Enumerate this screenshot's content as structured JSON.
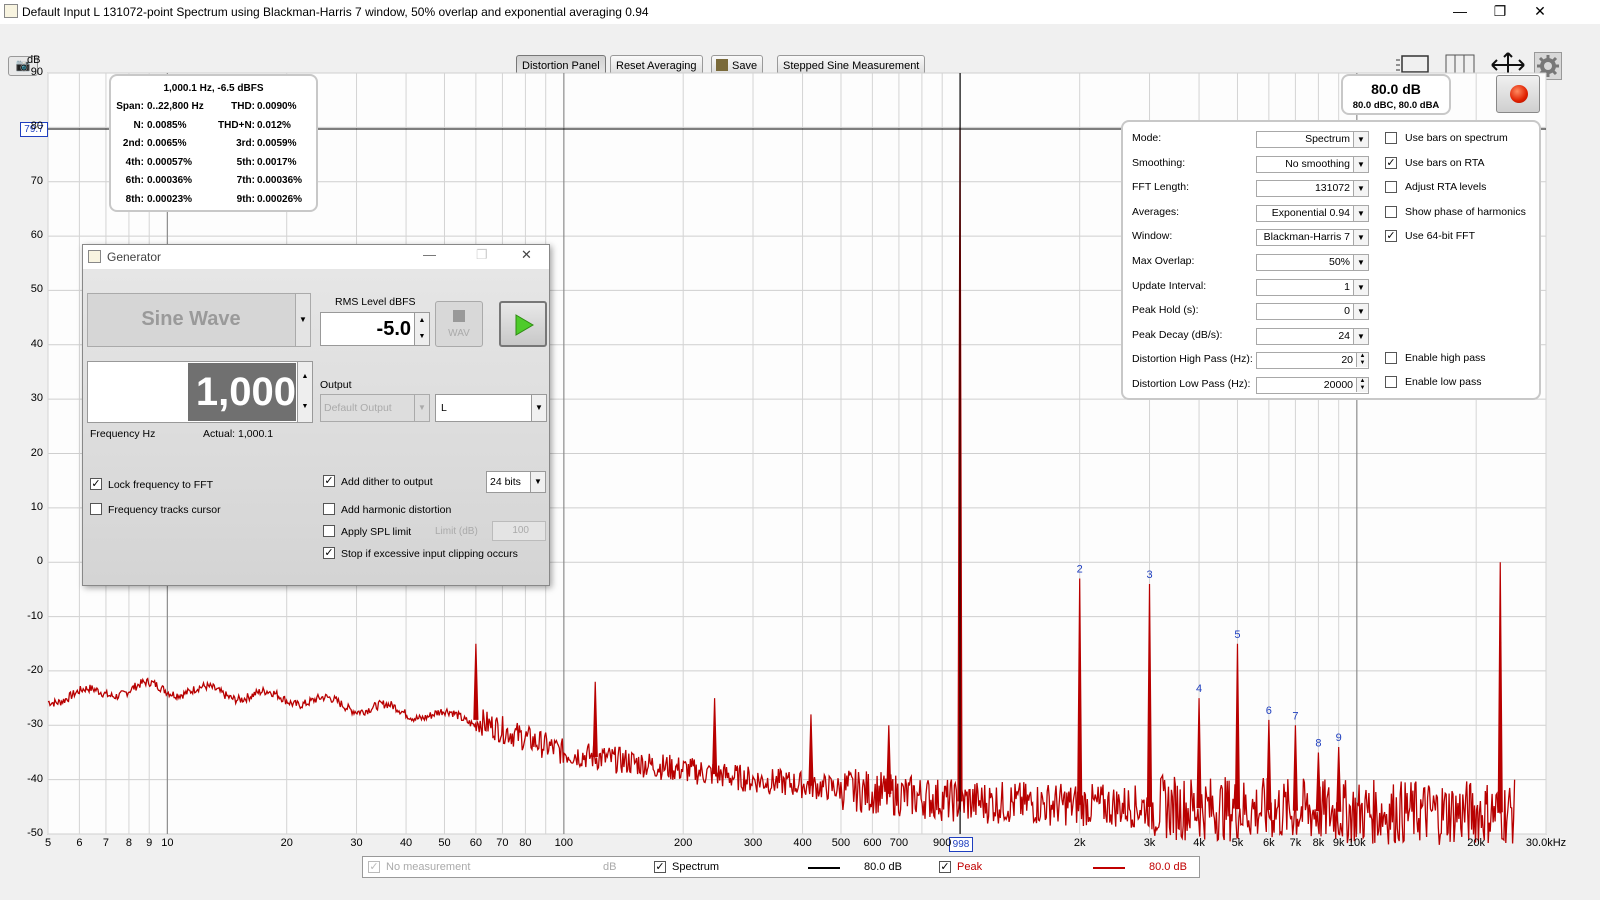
{
  "window": {
    "title": "Default Input L 131072-point Spectrum using Blackman-Harris 7 window, 50% overlap and exponential averaging 0.94",
    "minimize": "—",
    "restore": "❐",
    "close": "✕"
  },
  "toolbar": {
    "distortion_panel": "Distortion Panel",
    "reset_averaging": "Reset Averaging",
    "save": "Save",
    "stepped_sine": "Stepped Sine Measurement"
  },
  "axis": {
    "y_unit": "dB",
    "cursor_y": "79.7",
    "cursor_x": "998",
    "y_ticks": [
      "90",
      "80",
      "70",
      "60",
      "50",
      "40",
      "30",
      "20",
      "10",
      "0",
      "-10",
      "-20",
      "-30",
      "-40",
      "-50"
    ],
    "x_ticks": [
      "5",
      "6",
      "7",
      "8",
      "9",
      "10",
      "20",
      "30",
      "40",
      "50",
      "60",
      "70",
      "80",
      "100",
      "200",
      "300",
      "400",
      "500",
      "600",
      "700",
      "900",
      "2k",
      "3k",
      "4k",
      "5k",
      "6k",
      "7k",
      "8k",
      "9k",
      "10k",
      "20k",
      "30.0kHz"
    ]
  },
  "distortion": {
    "header": "1,000.1 Hz, -6.5 dBFS",
    "rows": [
      [
        "Span:",
        "0..22,800 Hz",
        "THD:",
        "0.0090%"
      ],
      [
        "N:",
        "0.0085%",
        "THD+N:",
        "0.012%"
      ],
      [
        "2nd:",
        "0.0065%",
        "3rd:",
        "0.0059%"
      ],
      [
        "4th:",
        "0.00057%",
        "5th:",
        "0.0017%"
      ],
      [
        "6th:",
        "0.00036%",
        "7th:",
        "0.00036%"
      ],
      [
        "8th:",
        "0.00023%",
        "9th:",
        "0.00026%"
      ]
    ]
  },
  "level": {
    "main": "80.0 dB",
    "sub": "80.0 dBC, 80.0 dBA"
  },
  "settings": {
    "rows": [
      {
        "label": "Mode:",
        "value": "Spectrum",
        "kind": "combo"
      },
      {
        "label": "Smoothing:",
        "value": "No  smoothing",
        "kind": "combo"
      },
      {
        "label": "FFT Length:",
        "value": "131072",
        "kind": "combo"
      },
      {
        "label": "Averages:",
        "value": "Exponential 0.94",
        "kind": "combo"
      },
      {
        "label": "Window:",
        "value": "Blackman-Harris 7",
        "kind": "combo"
      },
      {
        "label": "Max Overlap:",
        "value": "50%",
        "kind": "combo"
      },
      {
        "label": "Update Interval:",
        "value": "1",
        "kind": "combo"
      },
      {
        "label": "Peak Hold (s):",
        "value": "0",
        "kind": "combo"
      },
      {
        "label": "Peak Decay (dB/s):",
        "value": "24",
        "kind": "combo"
      },
      {
        "label": "Distortion High Pass (Hz):",
        "value": "20",
        "kind": "spin"
      },
      {
        "label": "Distortion Low Pass (Hz):",
        "value": "20000",
        "kind": "spin"
      }
    ],
    "checks": [
      {
        "label": "Use bars on spectrum",
        "checked": false
      },
      {
        "label": "Use bars on RTA",
        "checked": true
      },
      {
        "label": "Adjust RTA levels",
        "checked": false
      },
      {
        "label": "Show phase of harmonics",
        "checked": false
      },
      {
        "label": "Use 64-bit FFT",
        "checked": true
      }
    ],
    "enable_high_pass": {
      "label": "Enable high pass",
      "checked": false
    },
    "enable_low_pass": {
      "label": "Enable low pass",
      "checked": false
    }
  },
  "generator": {
    "title": "Generator",
    "signal_type": "Sine Wave",
    "rms_label": "RMS Level dBFS",
    "rms_value": "-5.0",
    "wav_label": "WAV",
    "frequency_value": "1,000",
    "frequency_label": "Frequency Hz",
    "actual": "Actual: 1,000.1",
    "output_label": "Output",
    "output_device": "Default Output",
    "output_channel": "L",
    "lock_freq": {
      "label": "Lock frequency to FFT",
      "checked": true
    },
    "freq_tracks": {
      "label": "Frequency tracks cursor",
      "checked": false
    },
    "add_dither": {
      "label": "Add dither to output",
      "checked": true
    },
    "dither_bits": "24 bits",
    "add_harmonic": {
      "label": "Add harmonic distortion",
      "checked": false
    },
    "apply_spl": {
      "label": "Apply SPL limit",
      "checked": false
    },
    "limit_label": "Limit (dB)",
    "limit_value": "100",
    "stop_clipping": {
      "label": "Stop if excessive input clipping occurs",
      "checked": true
    }
  },
  "legend": {
    "no_measurement": "No measurement",
    "no_measurement_unit": "dB",
    "spectrum": "Spectrum",
    "spectrum_value": "80.0 dB",
    "peak": "Peak",
    "peak_value": "80.0 dB",
    "peak_color": "#c00000"
  },
  "chart_data": {
    "type": "line",
    "xlabel": "",
    "ylabel": "dB",
    "x_scale": "log",
    "xlim": [
      5,
      30000
    ],
    "ylim": [
      -50,
      90
    ],
    "series": [
      {
        "name": "Peak",
        "color": "#b80000"
      }
    ],
    "noise_floor": {
      "x": [
        5,
        9,
        20,
        60,
        100,
        300,
        1000,
        3000,
        10000,
        25000
      ],
      "y": [
        -25,
        -23,
        -25,
        -29,
        -35,
        -40,
        -44,
        -45,
        -46,
        -46
      ]
    },
    "peaks": [
      {
        "x": 60,
        "y": -15
      },
      {
        "x": 120,
        "y": -22
      },
      {
        "x": 240,
        "y": -25
      },
      {
        "x": 420,
        "y": -28
      },
      {
        "x": 660,
        "y": -30
      },
      {
        "x": 998,
        "y": 80
      },
      {
        "x": 2000,
        "y": -3,
        "label": "2"
      },
      {
        "x": 3000,
        "y": -4,
        "label": "3"
      },
      {
        "x": 4000,
        "y": -25,
        "label": "4"
      },
      {
        "x": 5000,
        "y": -15,
        "label": "5"
      },
      {
        "x": 6000,
        "y": -29,
        "label": "6"
      },
      {
        "x": 7000,
        "y": -30,
        "label": "7"
      },
      {
        "x": 8000,
        "y": -35,
        "label": "8"
      },
      {
        "x": 9000,
        "y": -34,
        "label": "9"
      },
      {
        "x": 23000,
        "y": 0
      }
    ],
    "cursor": {
      "x": 998,
      "y": 79.7
    }
  }
}
